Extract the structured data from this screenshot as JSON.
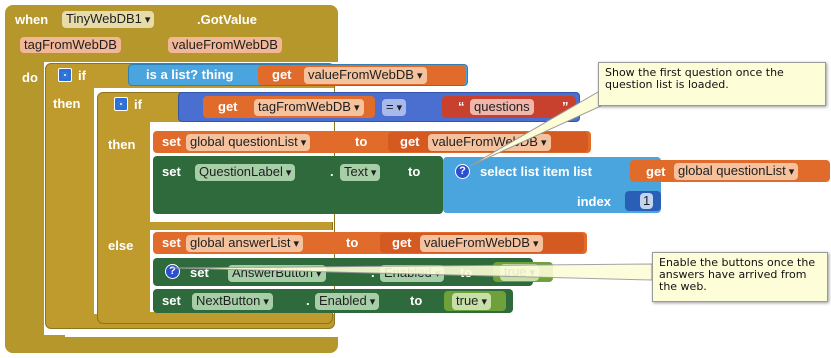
{
  "event": {
    "when": "when",
    "component": "TinyWebDB1",
    "event_name": ".GotValue",
    "param1": "tagFromWebDB",
    "param2": "valueFromWebDB",
    "do": "do"
  },
  "outer_if": {
    "if": "if",
    "then": "then",
    "condition_label": "is a list?  thing",
    "get": "get",
    "var": "valueFromWebDB"
  },
  "inner_if": {
    "if": "if",
    "then": "then",
    "else": "else",
    "get": "get",
    "var": "tagFromWebDB",
    "op": "=",
    "text": "questions"
  },
  "then_blocks": {
    "set1": "set",
    "global1": "global questionList",
    "to1": "to",
    "get1": "get",
    "var1": "valueFromWebDB",
    "set2": "set",
    "component2": "QuestionLabel",
    "dot": ".",
    "prop2": "Text",
    "to2": "to",
    "select_label": "select list item  list",
    "get3": "get",
    "var3": "global questionList",
    "index_label": "index",
    "index_value": "1"
  },
  "else_blocks": {
    "set1": "set",
    "global1": "global answerList",
    "to1": "to",
    "get1": "get",
    "var1": "valueFromWebDB",
    "set2": "set",
    "component2": "AnswerButton",
    "prop2": "Enabled",
    "to2": "to",
    "value2": "true",
    "set3": "set",
    "component3": "NextButton",
    "prop3": "Enabled",
    "to3": "to",
    "value3": "true"
  },
  "comments": {
    "c1": "Show the first question once the question list is loaded.",
    "c2": "Enable the buttons once the answers have arrived from the web."
  },
  "colors": {
    "event": "#b5972c",
    "control": "#bf9a2c",
    "variable_get": "#e06b2b",
    "list_blue": "#4aa5de",
    "component_green": "#2f6a3c",
    "text_red": "#c8412e",
    "logic_green": "#6fa13a",
    "comment_bg": "#fdfdd8"
  }
}
